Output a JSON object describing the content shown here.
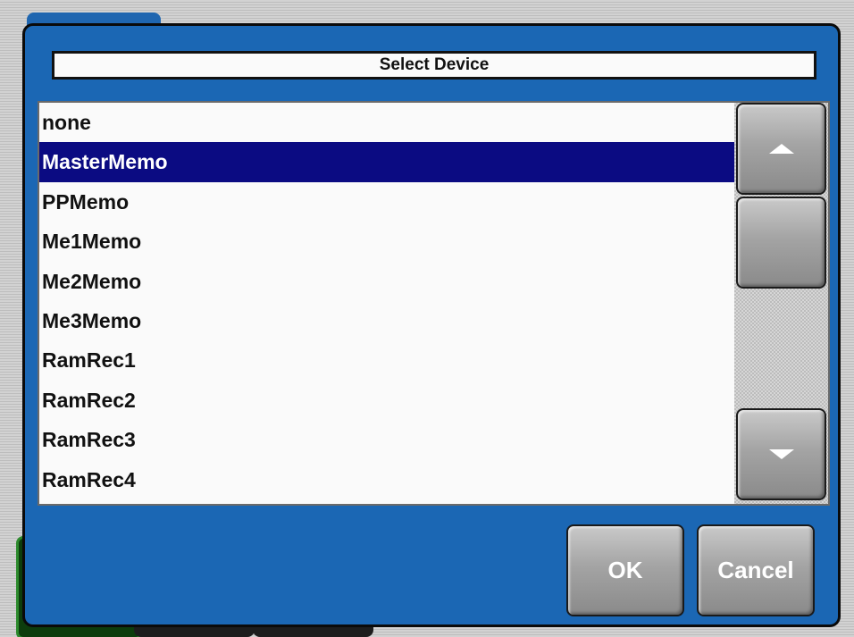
{
  "dialog": {
    "title": "Select Device",
    "items": [
      {
        "label": "none"
      },
      {
        "label": "MasterMemo"
      },
      {
        "label": "PPMemo"
      },
      {
        "label": "Me1Memo"
      },
      {
        "label": "Me2Memo"
      },
      {
        "label": "Me3Memo"
      },
      {
        "label": "RamRec1"
      },
      {
        "label": "RamRec2"
      },
      {
        "label": "RamRec3"
      },
      {
        "label": "RamRec4"
      }
    ],
    "selected_index": 1,
    "ok_label": "OK",
    "cancel_label": "Cancel"
  },
  "icons": {
    "scroll_up": "triangle-up-icon",
    "scroll_down": "triangle-down-icon"
  },
  "colors": {
    "dialog_background": "#1b67b4",
    "selection_background": "#0b0b82",
    "selection_text": "#ffffff",
    "list_background": "#fafafa"
  }
}
